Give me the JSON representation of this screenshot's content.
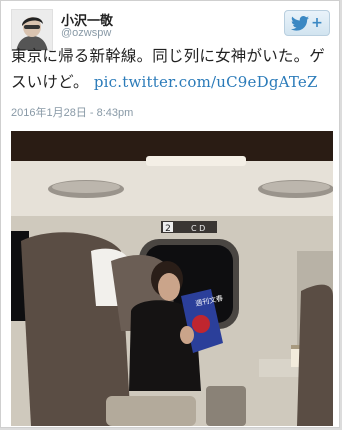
{
  "user": {
    "name": "小沢一敬",
    "handle": "@ozwspw"
  },
  "follow_button": {
    "icon": "twitter-bird-icon",
    "plus": "+"
  },
  "tweet": {
    "text": "東京に帰る新幹線。同じ列に女神がいた。ゲスいけど。",
    "link": "pic.twitter.com/uC9eDgATeZ"
  },
  "timestamp": "2016年1月28日 - 8:43pm",
  "photo": {
    "seat_sign_number": "2",
    "seat_sign_letters": "C  D",
    "magazine_title": "週刊文春"
  },
  "colors": {
    "link": "#2b7bb9",
    "meta": "#8899a6",
    "follow_icon": "#3b88c3"
  }
}
